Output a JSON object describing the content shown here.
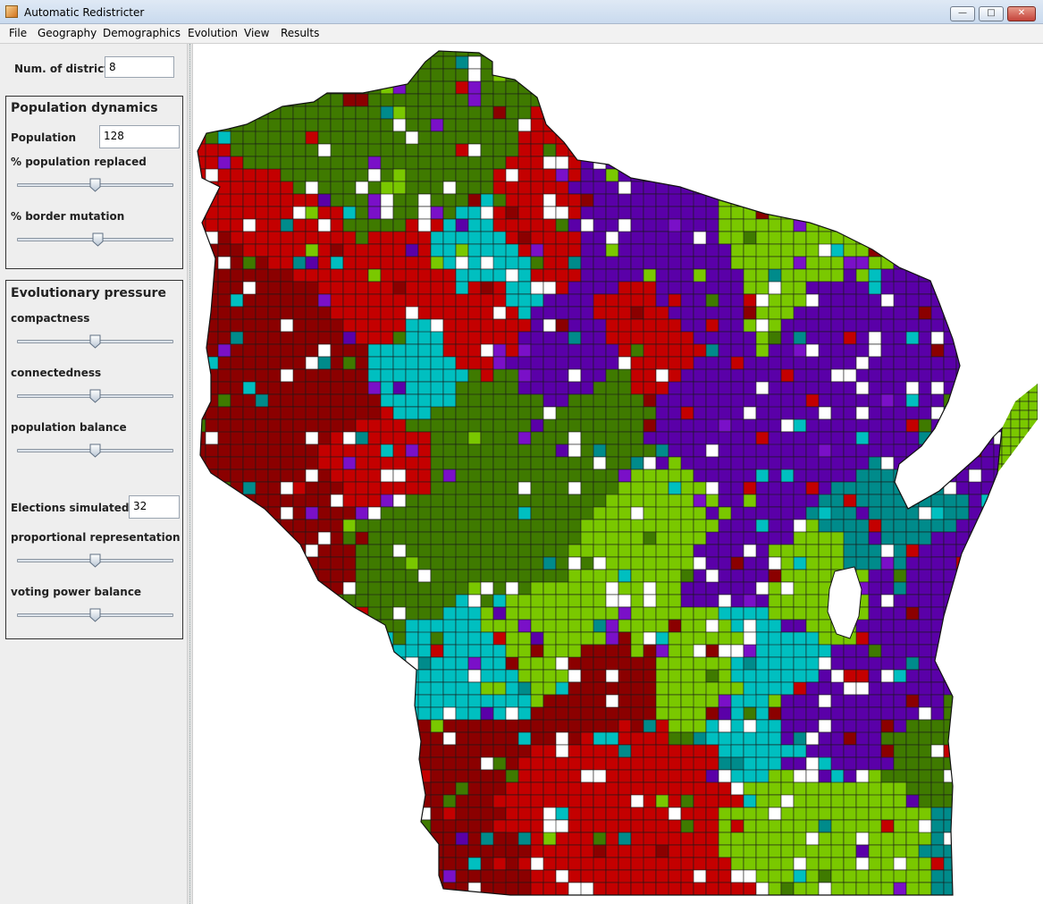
{
  "window": {
    "title": "Automatic Redistricter",
    "min_icon": "minimize-icon",
    "max_icon": "maximize-icon",
    "close_icon": "close-icon"
  },
  "menu": [
    "File",
    "Geography",
    "Demographics",
    "Evolution",
    "View",
    "Results"
  ],
  "settings": {
    "num_districts_label": "Num. of districts",
    "num_districts_value": "8"
  },
  "population_dynamics": {
    "title": "Population dynamics",
    "population_label": "Population",
    "population_value": "128",
    "replaced_label": "% population replaced",
    "replaced_level": 0.5,
    "border_mutation_label": "% border mutation",
    "border_mutation_level": 0.52
  },
  "evolutionary_pressure": {
    "title": "Evolutionary pressure",
    "compactness_label": "compactness",
    "compactness_level": 0.5,
    "connectedness_label": "connectedness",
    "connectedness_level": 0.5,
    "population_balance_label": "population balance",
    "population_balance_level": 0.5,
    "elections_label": "Elections simulated",
    "elections_value": "32",
    "proportional_label": "proportional representation",
    "proportional_level": 0.5,
    "voting_power_label": "voting power balance",
    "voting_power_level": 0.5
  },
  "map": {
    "district_colors": [
      "#c40000",
      "#8b0000",
      "#3f7a00",
      "#7ac800",
      "#00bfc0",
      "#008b8b",
      "#5a00a8",
      "#7a10c8"
    ],
    "border_color": "#1a1a1a",
    "unassigned_color": "#ffffff"
  }
}
